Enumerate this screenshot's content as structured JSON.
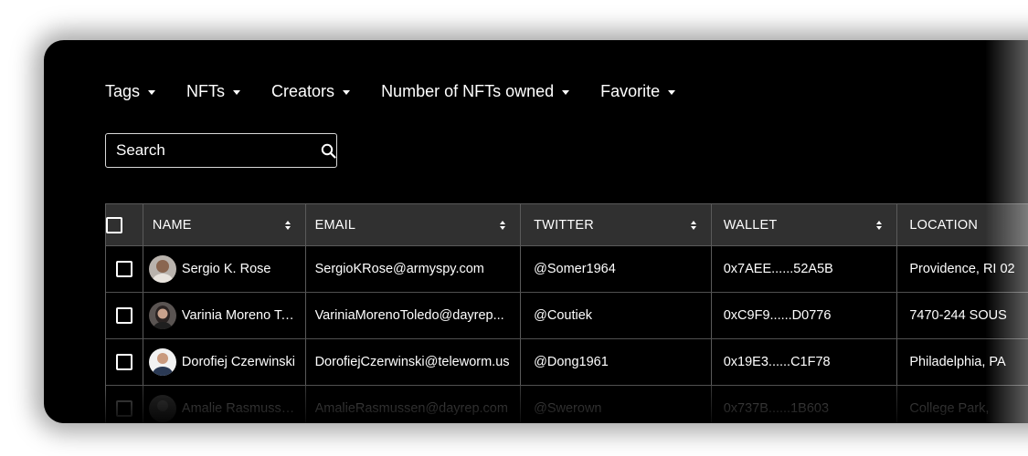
{
  "filters": [
    {
      "label": "Tags"
    },
    {
      "label": "NFTs"
    },
    {
      "label": "Creators"
    },
    {
      "label": "Number of NFTs owned"
    },
    {
      "label": "Favorite"
    }
  ],
  "search": {
    "placeholder": "Search",
    "icon": "search-icon"
  },
  "table": {
    "columns": [
      "NAME",
      "EMAIL",
      "TWITTER",
      "WALLET",
      "LOCATION"
    ],
    "rows": [
      {
        "name": "Sergio K. Rose",
        "email": "SergioKRose@armyspy.com",
        "twitter": "@Somer1964",
        "wallet": "0x7AEE......52A5B",
        "location": "Providence, RI 02"
      },
      {
        "name": "Varinia Moreno To...",
        "email": "VariniaMorenoToledo@dayrep...",
        "twitter": "@Coutiek",
        "wallet": "0xC9F9......D0776",
        "location": "7470-244 SOUS"
      },
      {
        "name": "Dorofiej Czerwinski",
        "email": "DorofiejCzerwinski@teleworm.us",
        "twitter": "@Dong1961",
        "wallet": "0x19E3......C1F78",
        "location": "Philadelphia, PA"
      },
      {
        "name": "Amalie Rasmussen",
        "email": "AmalieRasmussen@dayrep.com",
        "twitter": "@Swerown",
        "wallet": "0x737B......1B603",
        "location": "College Park, "
      }
    ]
  },
  "colors": {
    "background": "#000000",
    "header": "#303030",
    "border": "#5a5a5a",
    "text": "#ffffff"
  }
}
